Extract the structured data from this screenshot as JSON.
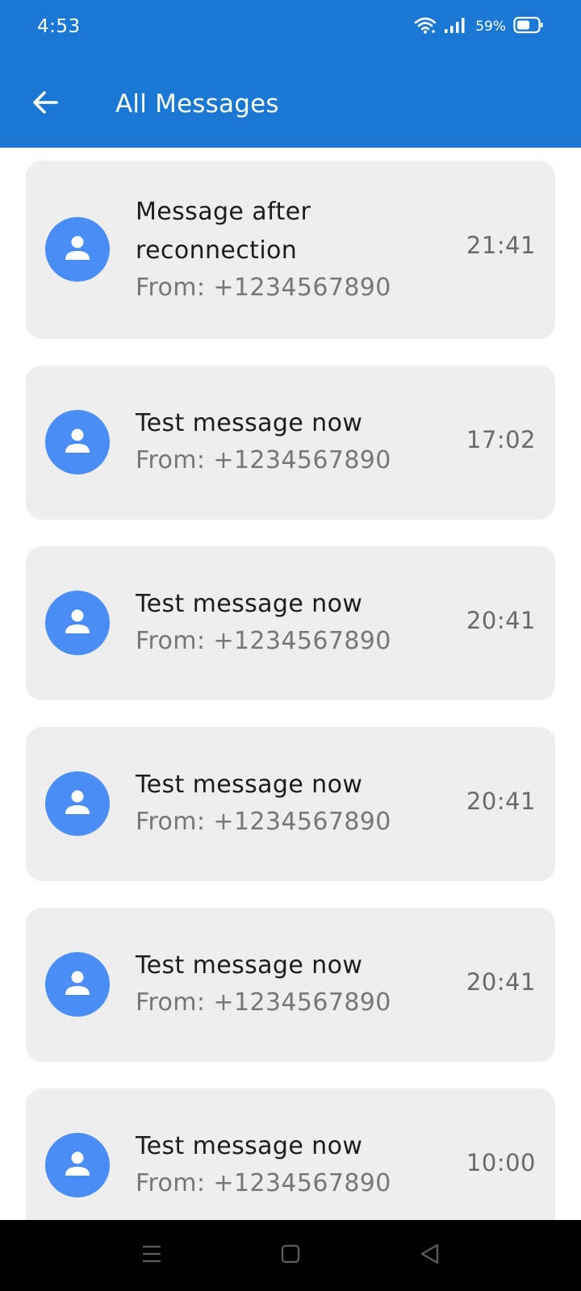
{
  "status_bar": {
    "time": "4:53",
    "battery": "59%",
    "icons": [
      "wifi-icon",
      "signal-icon",
      "battery-icon"
    ]
  },
  "header": {
    "title": "All Messages",
    "back_icon": "arrow-left-icon"
  },
  "colors": {
    "app_bar": "#1a78d4",
    "avatar": "#4a8df6",
    "card": "#eeeeee"
  },
  "messages": [
    {
      "title": "Message after reconnection",
      "from": "From: +1234567890",
      "time": "21:41"
    },
    {
      "title": "Test message now",
      "from": "From: +1234567890",
      "time": "17:02"
    },
    {
      "title": "Test message now",
      "from": "From: +1234567890",
      "time": "20:41"
    },
    {
      "title": "Test message now",
      "from": "From: +1234567890",
      "time": "20:41"
    },
    {
      "title": "Test message now",
      "from": "From: +1234567890",
      "time": "20:41"
    },
    {
      "title": "Test message now",
      "from": "From: +1234567890",
      "time": "10:00"
    }
  ],
  "nav_bar": {
    "buttons": [
      "menu-icon",
      "home-square-icon",
      "back-triangle-icon"
    ]
  }
}
